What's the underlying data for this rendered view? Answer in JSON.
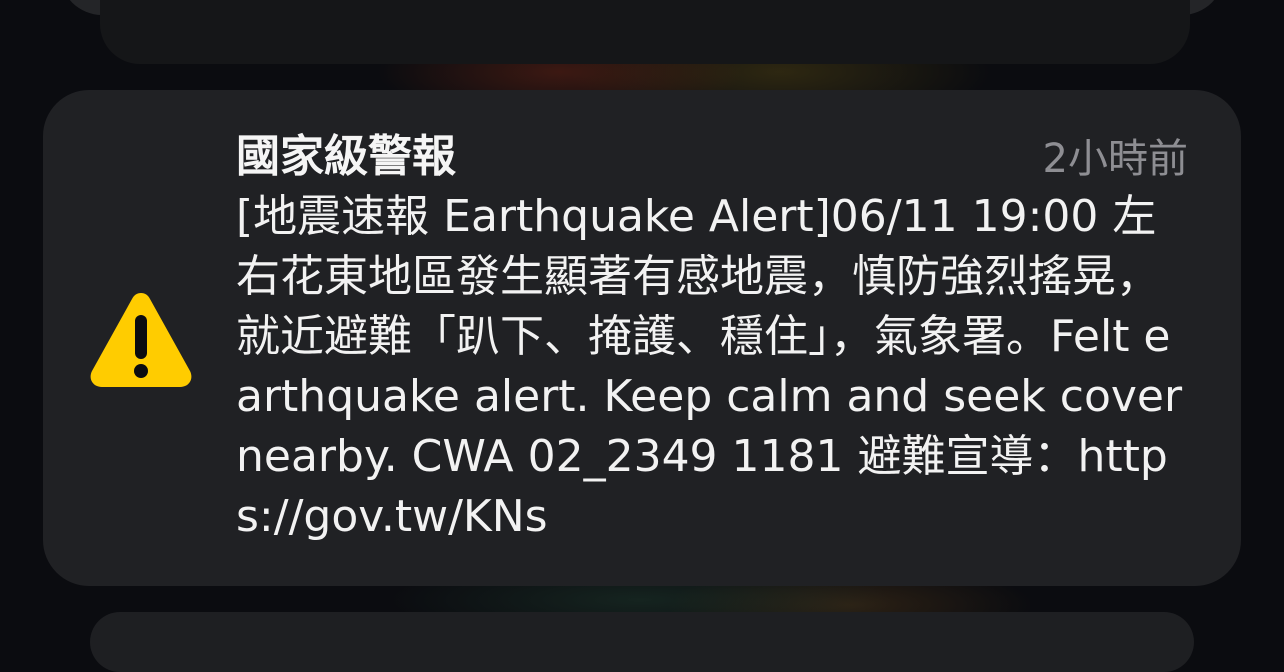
{
  "notification": {
    "title": "國家級警報",
    "time": "2小時前",
    "body": "[地震速報 Earthquake Alert]06/11 19:00 左右花東地區發生顯著有感地震，慎防強烈搖晃，就近避難「趴下、掩護、穩住」，氣象署。Felt earthquake alert. Keep calm and seek cover nearby. CWA 02_2349 1181 避難宣導：https://gov.tw/KNs",
    "icon": "warning-triangle-icon"
  },
  "colors": {
    "card_background": "#202124",
    "warning_icon": "#ffcc00",
    "title_text": "#f5f5f5",
    "time_text": "#8e8e93",
    "page_background": "#0b0c10"
  }
}
